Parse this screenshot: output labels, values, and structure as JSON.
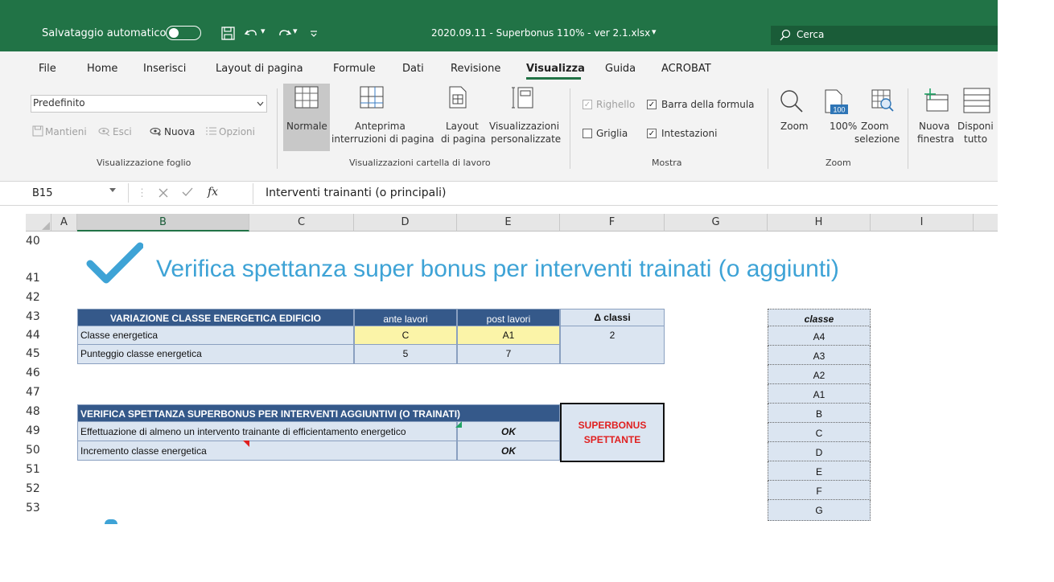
{
  "titlebar": {
    "autosave_label": "Salvataggio automatico",
    "file_title": "2020.09.11 - Superbonus 110% - ver 2.1.xlsx",
    "dropdown_glyph": "▾",
    "search_placeholder": "Cerca"
  },
  "menu": [
    "File",
    "Home",
    "Inserisci",
    "Layout di pagina",
    "Formule",
    "Dati",
    "Revisione",
    "Visualizza",
    "Guida",
    "ACROBAT"
  ],
  "ribbon": {
    "view_select_value": "Predefinito",
    "sheet_view_buttons": [
      "Mantieni",
      "Esci",
      "Nuova",
      "Opzioni"
    ],
    "normale": "Normale",
    "anteprima_line1": "Anteprima",
    "anteprima_line2": "interruzioni di pagina",
    "layout_line1": "Layout",
    "layout_line2": "di pagina",
    "visual_line1": "Visualizzazioni",
    "visual_line2": "personalizzate",
    "righello": "Righello",
    "barra_formula": "Barra della formula",
    "griglia": "Griglia",
    "intestazioni": "Intestazioni",
    "zoom": "Zoom",
    "zoom100": "100%",
    "zoom_sel_line1": "Zoom",
    "zoom_sel_line2": "selezione",
    "zoom100_icon_text": "100",
    "nuova_line1": "Nuova",
    "nuova_line2": "finestra",
    "disponi_line1": "Disponi",
    "disponi_line2": "tutto",
    "groups": {
      "visualizzazione_foglio": "Visualizzazione foglio",
      "visualizzazioni_cartella": "Visualizzazioni cartella di lavoro",
      "mostra": "Mostra",
      "zoom": "Zoom"
    }
  },
  "formulabar": {
    "name_box": "B15",
    "fx_label": "fx",
    "content": "Interventi trainanti (o principali)"
  },
  "grid": {
    "columns": [
      "A",
      "B",
      "C",
      "D",
      "E",
      "F",
      "G",
      "H",
      "I"
    ],
    "selected_column": "B",
    "rows": [
      "40",
      "41",
      "42",
      "43",
      "44",
      "45",
      "46",
      "47",
      "48",
      "49",
      "50",
      "51",
      "52",
      "53"
    ]
  },
  "sheet": {
    "heading": "Verifica spettanza super bonus per interventi trainati (o aggiunti)",
    "heading_color": "#3ea3d6",
    "table1": {
      "headers": [
        "VARIAZIONE CLASSE ENERGETICA EDIFICIO",
        "ante lavori",
        "post lavori",
        "Δ classi"
      ],
      "rows": [
        [
          "Classe energetica",
          "C",
          "A1",
          "2"
        ],
        [
          "Punteggio classe energetica",
          "5",
          "7",
          ""
        ]
      ]
    },
    "table2": {
      "header": "VERIFICA SPETTANZA SUPERBONUS PER INTERVENTI AGGIUNTIVI (O TRAINATI)",
      "rows": [
        [
          "Effettuazione di almeno un intervento trainante di efficientamento energetico",
          "OK"
        ],
        [
          "Incremento classe energetica",
          "OK"
        ]
      ]
    },
    "result_box": [
      "SUPERBONUS",
      "SPETTANTE"
    ],
    "result_color": "#e02020",
    "classe_table": {
      "header": "classe",
      "values": [
        "A4",
        "A3",
        "A2",
        "A1",
        "B",
        "C",
        "D",
        "E",
        "F",
        "G"
      ]
    }
  }
}
